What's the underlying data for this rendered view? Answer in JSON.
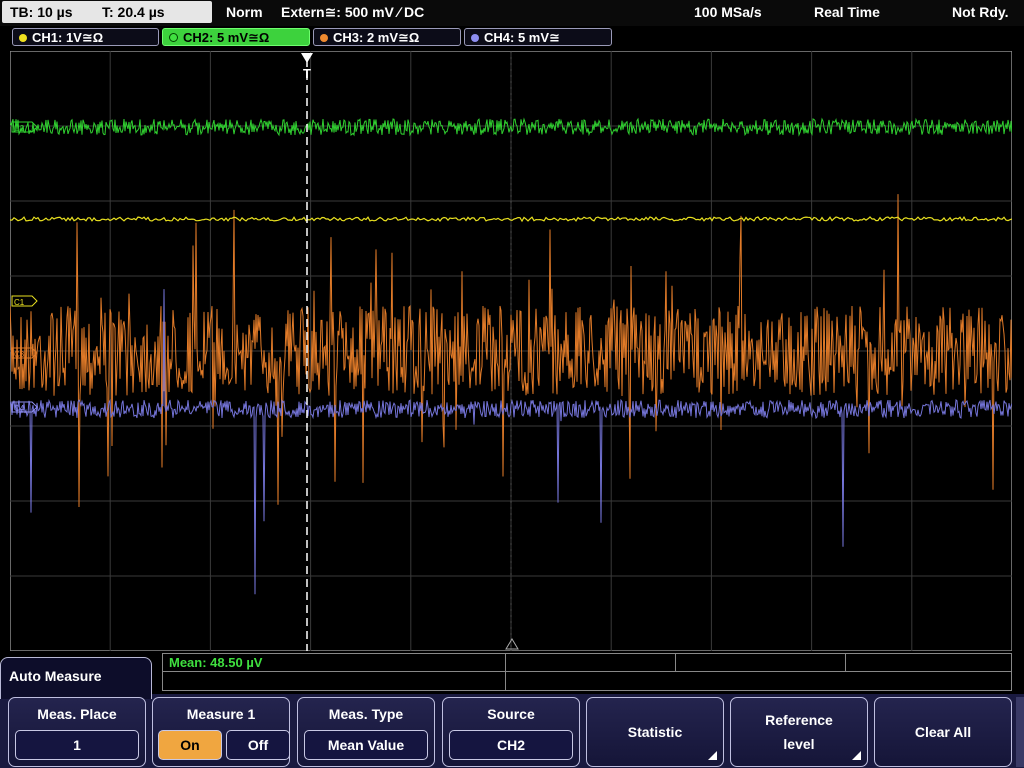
{
  "status": {
    "timebase": "TB: 10 µs",
    "trigger_time": "T: 20.4 µs",
    "mode": "Norm",
    "trigger_source": "Extern≅: 500 mV ∕ DC",
    "sample_rate": "100 MSa/s",
    "acq_mode": "Real Time",
    "state": "Not Rdy."
  },
  "channels": [
    {
      "label": "CH1: 1V≅Ω",
      "color": "#f0e020"
    },
    {
      "label": "CH2: 5 mV≅Ω",
      "color": "#40e040"
    },
    {
      "label": "CH3: 2 mV≅Ω",
      "color": "#f08a30"
    },
    {
      "label": "CH4: 5 mV≅",
      "color": "#8e8ef0"
    }
  ],
  "markers": {
    "trigger": "T",
    "c2": "C2",
    "c1": "C1",
    "c3": "C3",
    "c4": "C4"
  },
  "result": {
    "mean": "Mean: 48.50 µV"
  },
  "menu": {
    "title": "Auto Measure",
    "meas_place": {
      "label": "Meas. Place",
      "value": "1"
    },
    "measure1": {
      "label": "Measure 1",
      "on": "On",
      "off": "Off",
      "state": "On"
    },
    "meas_type": {
      "label": "Meas. Type",
      "value": "Mean Value"
    },
    "source": {
      "label": "Source",
      "value": "CH2"
    },
    "statistic": {
      "label": "Statistic"
    },
    "reference": {
      "line1": "Reference",
      "line2": "level"
    },
    "clear_all": {
      "label": "Clear All"
    }
  }
}
